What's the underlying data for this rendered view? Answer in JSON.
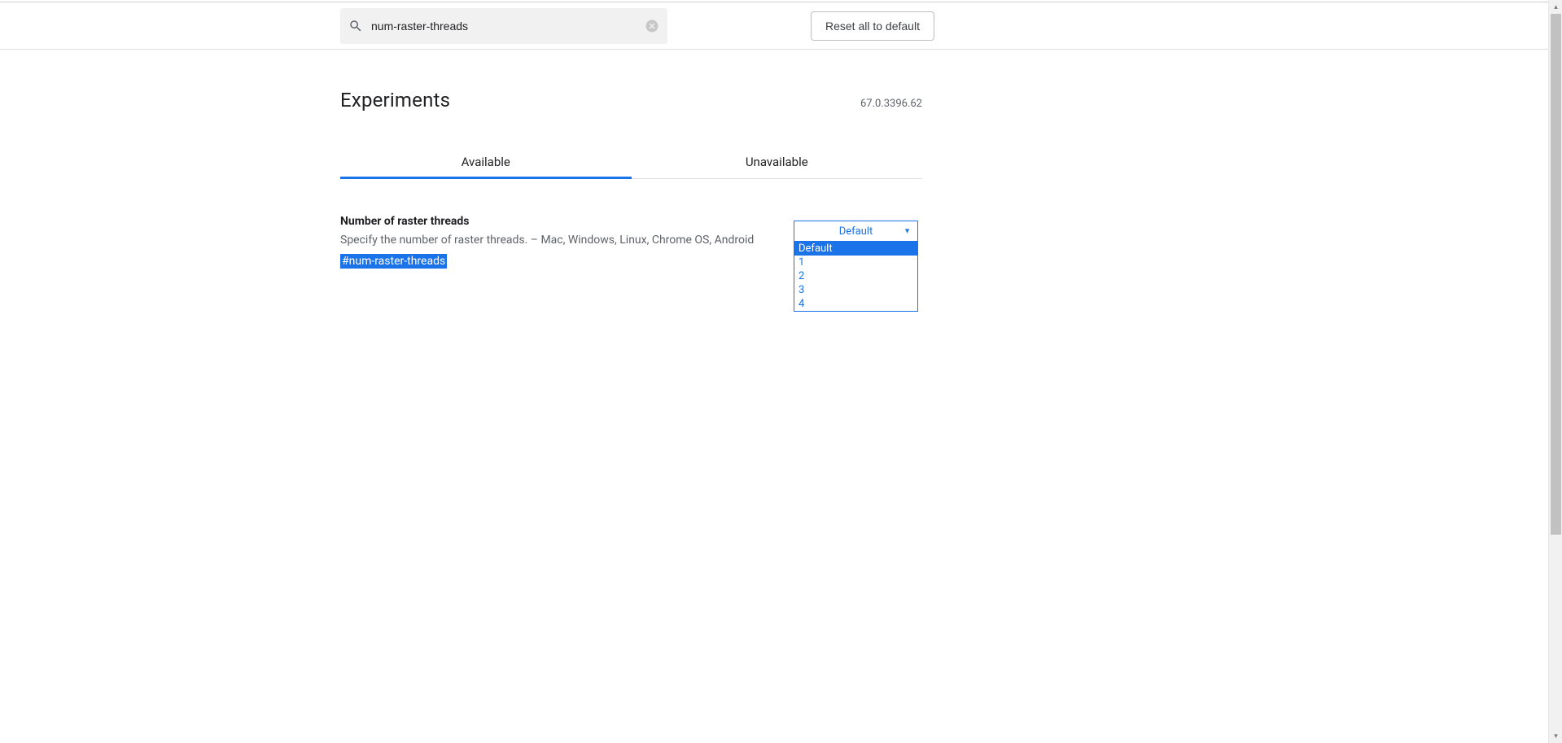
{
  "search": {
    "value": "num-raster-threads"
  },
  "reset_label": "Reset all to default",
  "page_title": "Experiments",
  "version": "67.0.3396.62",
  "tabs": {
    "available": "Available",
    "unavailable": "Unavailable"
  },
  "flag": {
    "title": "Number of raster threads",
    "desc": "Specify the number of raster threads. – Mac, Windows, Linux, Chrome OS, Android",
    "hash": "#num-raster-threads",
    "selected": "Default",
    "options": [
      "Default",
      "1",
      "2",
      "3",
      "4"
    ]
  }
}
